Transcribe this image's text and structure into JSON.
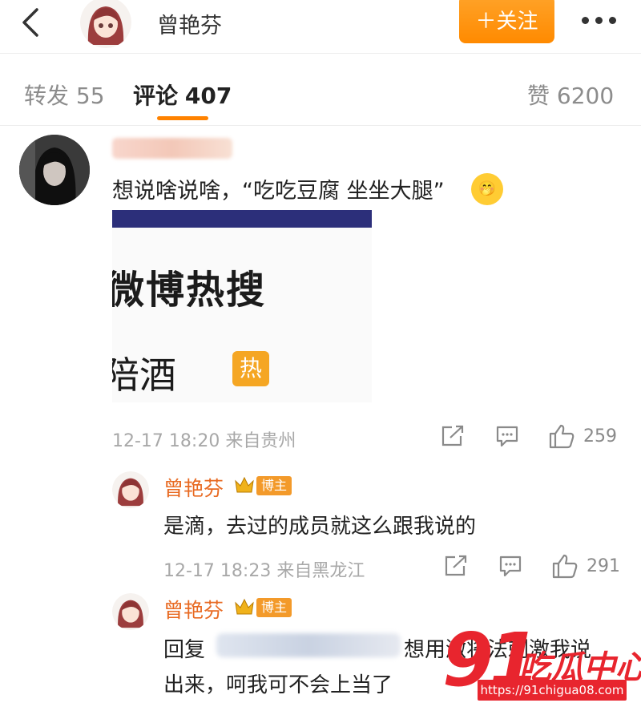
{
  "header": {
    "name": "曾艳芬",
    "follow_label": "＋关注"
  },
  "tabs": {
    "repost_label": "转发",
    "repost_count": "55",
    "comment_label": "评论",
    "comment_count": "407",
    "like_label": "赞",
    "like_count": "6200"
  },
  "comment": {
    "text": "想说啥说啥，“吃吃豆腐 坐坐大腿”",
    "image": {
      "title": "微博热搜",
      "row_text": "陪酒",
      "badge": "热"
    },
    "time": "12-17 18:20",
    "source": "来自贵州",
    "likes": "259"
  },
  "replies": [
    {
      "name": "曾艳芬",
      "badge": "博主",
      "text": "是滴，去过的成员就这么跟我说的",
      "time": "12-17 18:23",
      "source": "来自黑龙江",
      "likes": "291"
    },
    {
      "name": "曾艳芬",
      "badge": "博主",
      "text_prefix": "回复",
      "text_line1_rest": "想用激将法刺激我说",
      "text_line2": "出来，呵我可不会上当了"
    }
  ],
  "watermark": {
    "number": "91",
    "text": "吃瓜中心",
    "url": "https://91chigua08.com"
  },
  "colors": {
    "accent": "#ff8200",
    "name_orange": "#e86a22",
    "watermark_red": "#e8252e"
  }
}
